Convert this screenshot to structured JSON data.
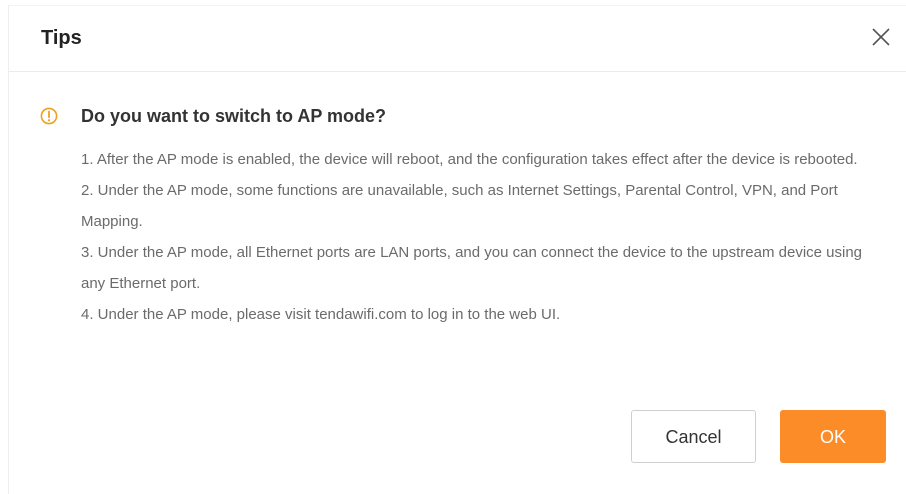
{
  "dialog": {
    "title": "Tips",
    "close_icon": "close-icon",
    "question": "Do you want to switch to AP mode?",
    "question_icon": "exclamation-circle-icon",
    "messages": [
      "1. After the AP mode is enabled, the device will reboot, and the configuration takes effect after the device is rebooted.",
      "2. Under the AP mode, some functions are unavailable, such as Internet Settings, Parental Control, VPN, and Port Mapping.",
      "3. Under the AP mode, all Ethernet ports are LAN ports, and you can connect the device to the upstream device using any Ethernet port.",
      "4. Under the AP mode, please visit tendawifi.com to log in to the web UI."
    ],
    "cancel_label": "Cancel",
    "ok_label": "OK"
  },
  "colors": {
    "accent": "#fb8c28",
    "warning_icon": "#f0a020",
    "message_text": "#6b6b6b"
  }
}
